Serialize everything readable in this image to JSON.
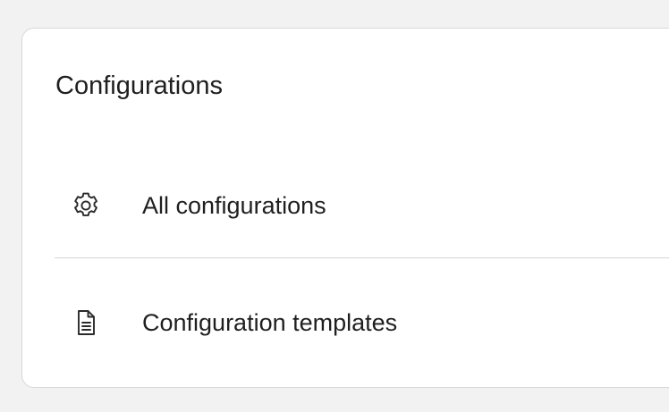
{
  "panel": {
    "title": "Configurations",
    "items": [
      {
        "label": "All configurations",
        "icon": "gear-icon"
      },
      {
        "label": "Configuration templates",
        "icon": "document-icon"
      }
    ]
  }
}
